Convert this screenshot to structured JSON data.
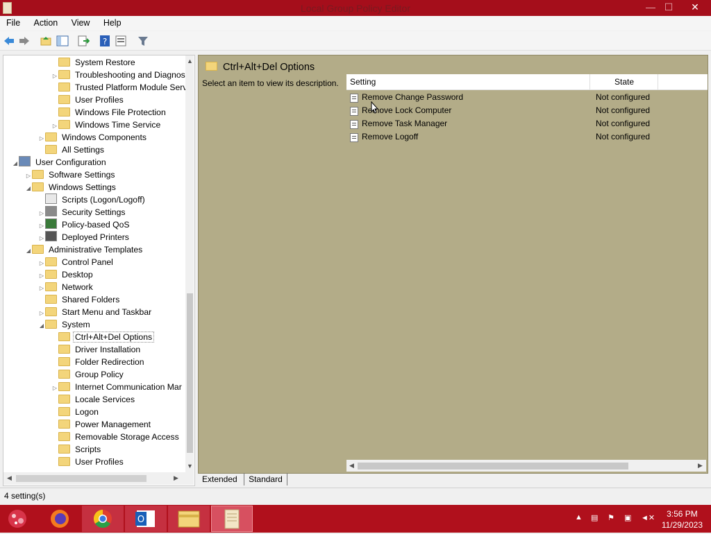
{
  "window": {
    "title": "Local Group Policy Editor",
    "minimize": "—",
    "maximize": "☐",
    "close": "✕"
  },
  "menu": [
    "File",
    "Action",
    "View",
    "Help"
  ],
  "tree": [
    {
      "label": "System Restore",
      "level": 4,
      "expander": ""
    },
    {
      "label": "Troubleshooting and Diagnos",
      "level": 4,
      "expander": "▷"
    },
    {
      "label": "Trusted Platform Module Serv",
      "level": 4,
      "expander": ""
    },
    {
      "label": "User Profiles",
      "level": 4,
      "expander": ""
    },
    {
      "label": "Windows File Protection",
      "level": 4,
      "expander": ""
    },
    {
      "label": "Windows Time Service",
      "level": 4,
      "expander": "▷"
    },
    {
      "label": "Windows Components",
      "level": 3,
      "expander": "▷"
    },
    {
      "label": "All Settings",
      "level": 3,
      "expander": ""
    },
    {
      "label": "User Configuration",
      "level": 1,
      "expander": "◢",
      "icon": "user"
    },
    {
      "label": "Software Settings",
      "level": 2,
      "expander": "▷"
    },
    {
      "label": "Windows Settings",
      "level": 2,
      "expander": "◢"
    },
    {
      "label": "Scripts (Logon/Logoff)",
      "level": 3,
      "expander": "",
      "icon": "script"
    },
    {
      "label": "Security Settings",
      "level": 3,
      "expander": "▷",
      "icon": "security"
    },
    {
      "label": "Policy-based QoS",
      "level": 3,
      "expander": "▷",
      "icon": "chart"
    },
    {
      "label": "Deployed Printers",
      "level": 3,
      "expander": "▷",
      "icon": "printer"
    },
    {
      "label": "Administrative Templates",
      "level": 2,
      "expander": "◢"
    },
    {
      "label": "Control Panel",
      "level": 3,
      "expander": "▷"
    },
    {
      "label": "Desktop",
      "level": 3,
      "expander": "▷"
    },
    {
      "label": "Network",
      "level": 3,
      "expander": "▷"
    },
    {
      "label": "Shared Folders",
      "level": 3,
      "expander": ""
    },
    {
      "label": "Start Menu and Taskbar",
      "level": 3,
      "expander": "▷"
    },
    {
      "label": "System",
      "level": 3,
      "expander": "◢"
    },
    {
      "label": "Ctrl+Alt+Del Options",
      "level": 4,
      "expander": "",
      "selected": true
    },
    {
      "label": "Driver Installation",
      "level": 4,
      "expander": ""
    },
    {
      "label": "Folder Redirection",
      "level": 4,
      "expander": ""
    },
    {
      "label": "Group Policy",
      "level": 4,
      "expander": ""
    },
    {
      "label": "Internet Communication Mar",
      "level": 4,
      "expander": "▷"
    },
    {
      "label": "Locale Services",
      "level": 4,
      "expander": ""
    },
    {
      "label": "Logon",
      "level": 4,
      "expander": ""
    },
    {
      "label": "Power Management",
      "level": 4,
      "expander": ""
    },
    {
      "label": "Removable Storage Access",
      "level": 4,
      "expander": ""
    },
    {
      "label": "Scripts",
      "level": 4,
      "expander": ""
    },
    {
      "label": "User Profiles",
      "level": 4,
      "expander": ""
    }
  ],
  "details": {
    "title": "Ctrl+Alt+Del Options",
    "description": "Select an item to view its description.",
    "col_setting": "Setting",
    "col_state": "State",
    "rows": [
      {
        "name": "Remove Change Password",
        "state": "Not configured"
      },
      {
        "name": "Remove Lock Computer",
        "state": "Not configured"
      },
      {
        "name": "Remove Task Manager",
        "state": "Not configured"
      },
      {
        "name": "Remove Logoff",
        "state": "Not configured"
      }
    ]
  },
  "tabs": [
    "Extended",
    "Standard"
  ],
  "status": "4 setting(s)",
  "taskbar": {
    "apps": [
      "firefox-icon",
      "chrome-icon",
      "outlook-icon",
      "file-explorer-icon",
      "group-policy-icon"
    ],
    "time": "3:56 PM",
    "date": "11/29/2023"
  },
  "colors": {
    "titlebar": "#a50e1b",
    "taskbar": "#b0101c",
    "right_panel": "#b3ac88"
  }
}
